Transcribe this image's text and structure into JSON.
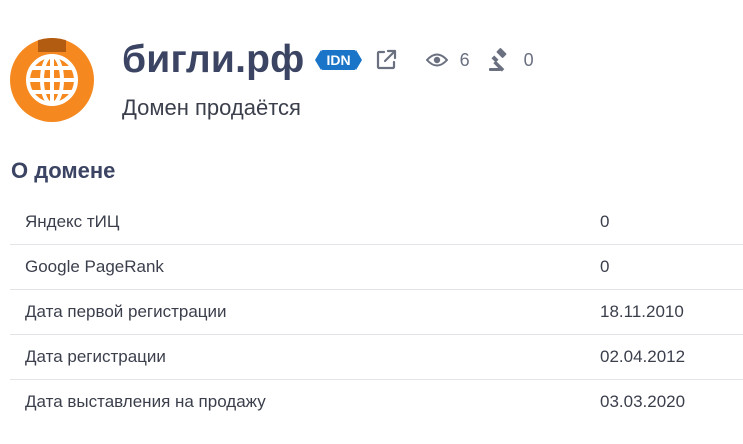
{
  "header": {
    "domain": "бигли.рф",
    "badge": "IDN",
    "views_count": "6",
    "bids_count": "0",
    "status": "Домен продаётся"
  },
  "icons": {
    "logo": "globe-icon",
    "external": "external-link-icon",
    "views": "eye-icon",
    "bids": "gavel-icon"
  },
  "colors": {
    "logo_bg": "#f5891f",
    "badge_bg": "#1a74c7",
    "title": "#3b4462"
  },
  "about": {
    "title": "О домене",
    "rows": [
      {
        "label": "Яндекс тИЦ",
        "value": "0"
      },
      {
        "label": "Google PageRank",
        "value": "0"
      },
      {
        "label": "Дата первой регистрации",
        "value": "18.11.2010"
      },
      {
        "label": "Дата регистрации",
        "value": "02.04.2012"
      },
      {
        "label": "Дата выставления на продажу",
        "value": "03.03.2020"
      }
    ]
  }
}
